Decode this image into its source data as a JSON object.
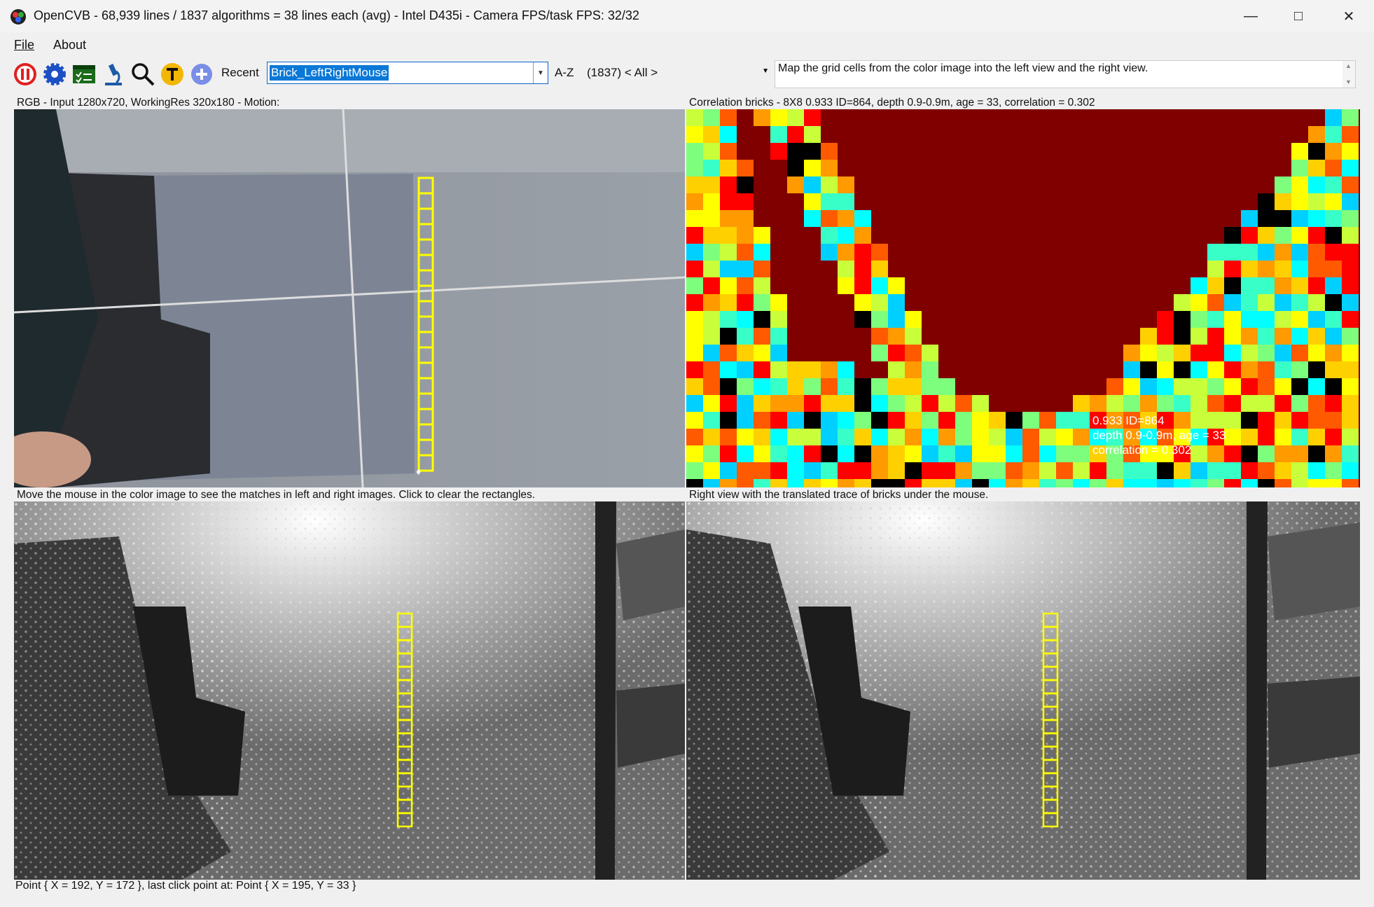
{
  "window": {
    "title": "OpenCVB - 68,939 lines / 1837 algorithms = 38 lines each (avg) - Intel D435i - Camera FPS/task FPS: 32/32",
    "controls": [
      "—",
      "□",
      "✕"
    ]
  },
  "menu": {
    "file": "File",
    "about": "About"
  },
  "toolbar": {
    "recent_label": "Recent",
    "algorithm_value": "Brick_LeftRightMouse",
    "az_label": "A-Z",
    "filter_value": "(1837) < All >",
    "description": "Map the grid cells from the color image into the left view and the right view."
  },
  "panels": {
    "rgb_caption": "RGB - Input 1280x720, WorkingRes 320x180 - Motion:",
    "correlation_caption": "Correlation bricks - 8X8  0.933 ID=864, depth 0.9-0.9m, age = 33, correlation = 0.302",
    "left_caption": "Move the mouse in the color image to see the matches in left and right images. Click to clear the rectangles.",
    "right_caption": "Right view with the translated trace of bricks under the mouse.",
    "overlay_line1": "0.933 ID=864",
    "overlay_line2": "depth 0.9-0.9m, age = 33",
    "overlay_line3": "correlation = 0.302"
  },
  "status": {
    "text": "Point { X = 192, Y = 172 }, last click point at: Point { X = 195, Y = 33 }"
  },
  "colors": {
    "heat_background": "#800000",
    "brick_outline": "#ffff00"
  }
}
